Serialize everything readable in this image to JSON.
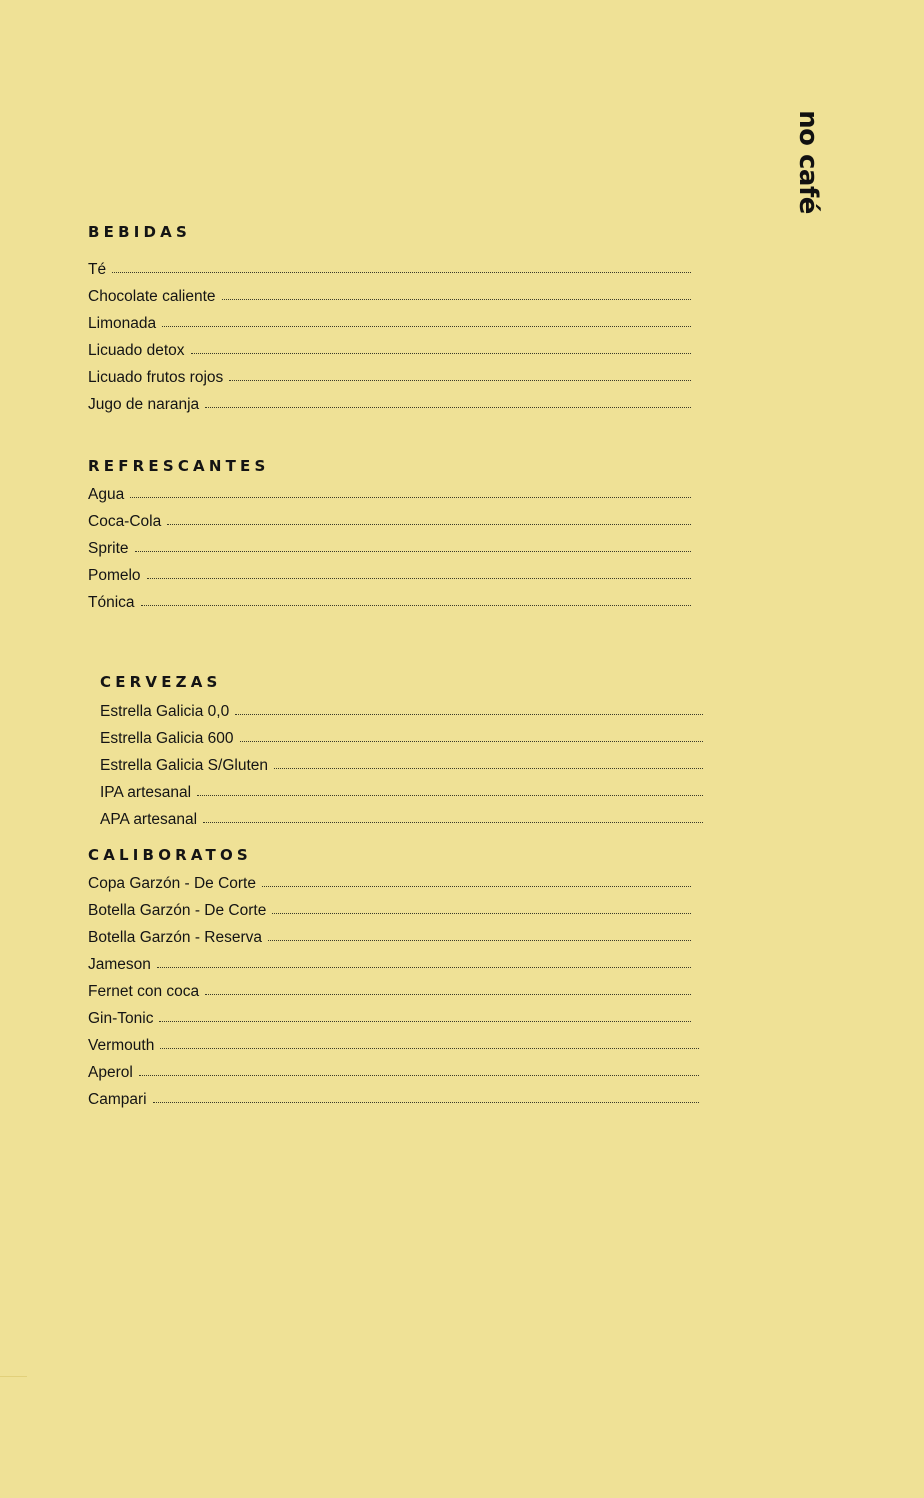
{
  "brand": "no café",
  "sections": [
    {
      "title": "BEBIDAS",
      "items": [
        "Té",
        "Chocolate caliente",
        "Limonada",
        "Licuado detox",
        "Licuado frutos rojos",
        "Jugo de naranja"
      ]
    },
    {
      "title": "REFRESCANTES",
      "items": [
        "Agua",
        "Coca-Cola",
        "Sprite",
        "Pomelo",
        "Tónica"
      ]
    },
    {
      "title": "CERVEZAS",
      "items": [
        "Estrella Galicia 0,0",
        "Estrella Galicia 600",
        "Estrella Galicia S/Gluten",
        "IPA artesanal",
        "APA artesanal"
      ]
    },
    {
      "title": "CALIBORATOS",
      "items": [
        "Copa Garzón - De Corte",
        "Botella Garzón - De Corte",
        "Botella Garzón - Reserva",
        "Jameson",
        "Fernet con coca",
        "Gin-Tonic",
        "Vermouth",
        "Aperol",
        "Campari"
      ]
    }
  ]
}
